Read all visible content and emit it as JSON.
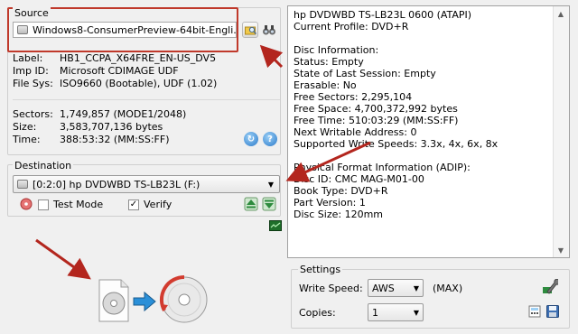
{
  "source": {
    "title": "Source",
    "file_name": "Windows8-ConsumerPreview-64bit-Engli...",
    "label_key": "Label:",
    "label_value": "HB1_CCPA_X64FRE_EN-US_DV5",
    "imp_id_key": "Imp ID:",
    "imp_id_value": "Microsoft CDIMAGE UDF",
    "file_sys_key": "File Sys:",
    "file_sys_value": "ISO9660 (Bootable), UDF (1.02)",
    "sectors_key": "Sectors:",
    "sectors_value": "1,749,857 (MODE1/2048)",
    "size_key": "Size:",
    "size_value": "3,583,707,136 bytes",
    "time_key": "Time:",
    "time_value": "388:53:32 (MM:SS:FF)"
  },
  "info": {
    "lines": [
      "hp DVDWBD TS-LB23L 0600 (ATAPI)",
      "Current Profile: DVD+R",
      "",
      "Disc Information:",
      "Status: Empty",
      "State of Last Session: Empty",
      "Erasable: No",
      "Free Sectors: 2,295,104",
      "Free Space: 4,700,372,992 bytes",
      "Free Time: 510:03:29 (MM:SS:FF)",
      "Next Writable Address: 0",
      "Supported Write Speeds: 3.3x, 4x, 6x, 8x",
      "",
      "Physical Format Information (ADIP):",
      "Disc ID: CMC MAG-M01-00",
      "Book Type: DVD+R",
      "Part Version: 1",
      "Disc Size: 120mm"
    ]
  },
  "destination": {
    "title": "Destination",
    "drive": "[0:2:0] hp DVDWBD TS-LB23L (F:)",
    "test_mode_label": "Test Mode",
    "test_mode_checked": false,
    "verify_label": "Verify",
    "verify_checked": true
  },
  "settings": {
    "title": "Settings",
    "write_speed_label": "Write Speed:",
    "write_speed_value": "AWS",
    "write_speed_max": "(MAX)",
    "copies_label": "Copies:",
    "copies_value": "1"
  },
  "colors": {
    "accent_red": "#c0392b",
    "arrow_red": "#b3261e"
  }
}
